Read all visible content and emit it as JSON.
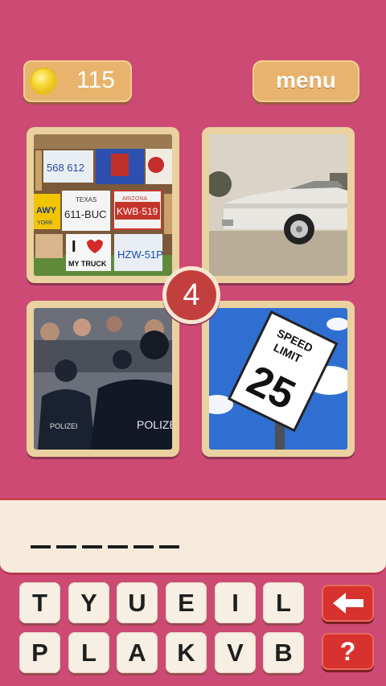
{
  "header": {
    "coin_count": "115",
    "coin_icon": "coin-icon",
    "menu_label": "menu"
  },
  "puzzle": {
    "letter_count": "4",
    "image_1": {
      "plates": [
        "568 612",
        "TEXAS",
        "611-BUC",
        "ARIZONA",
        "KWB·519",
        "I",
        "MY TRUCK",
        "HZW-51P",
        "AWY",
        "YORK"
      ]
    },
    "image_4": {
      "sign_top": "SPEED",
      "sign_mid": "LIMIT",
      "sign_num": "25"
    },
    "image_3": {
      "vest_text": "POLIZEI",
      "vest_text_2": "POLIZEI"
    }
  },
  "answer": {
    "slots": [
      "",
      "",
      "",
      "",
      "",
      ""
    ]
  },
  "keyboard": {
    "row1": [
      "T",
      "Y",
      "U",
      "E",
      "I",
      "L"
    ],
    "row2": [
      "P",
      "L",
      "A",
      "K",
      "V",
      "B"
    ],
    "delete_icon": "arrow-left-icon",
    "hint_label": "?"
  },
  "colors": {
    "background": "#cc4a74",
    "button_gold": "#e8b36c",
    "action_red": "#d8322e",
    "tile_frame": "#e9d2a0"
  }
}
